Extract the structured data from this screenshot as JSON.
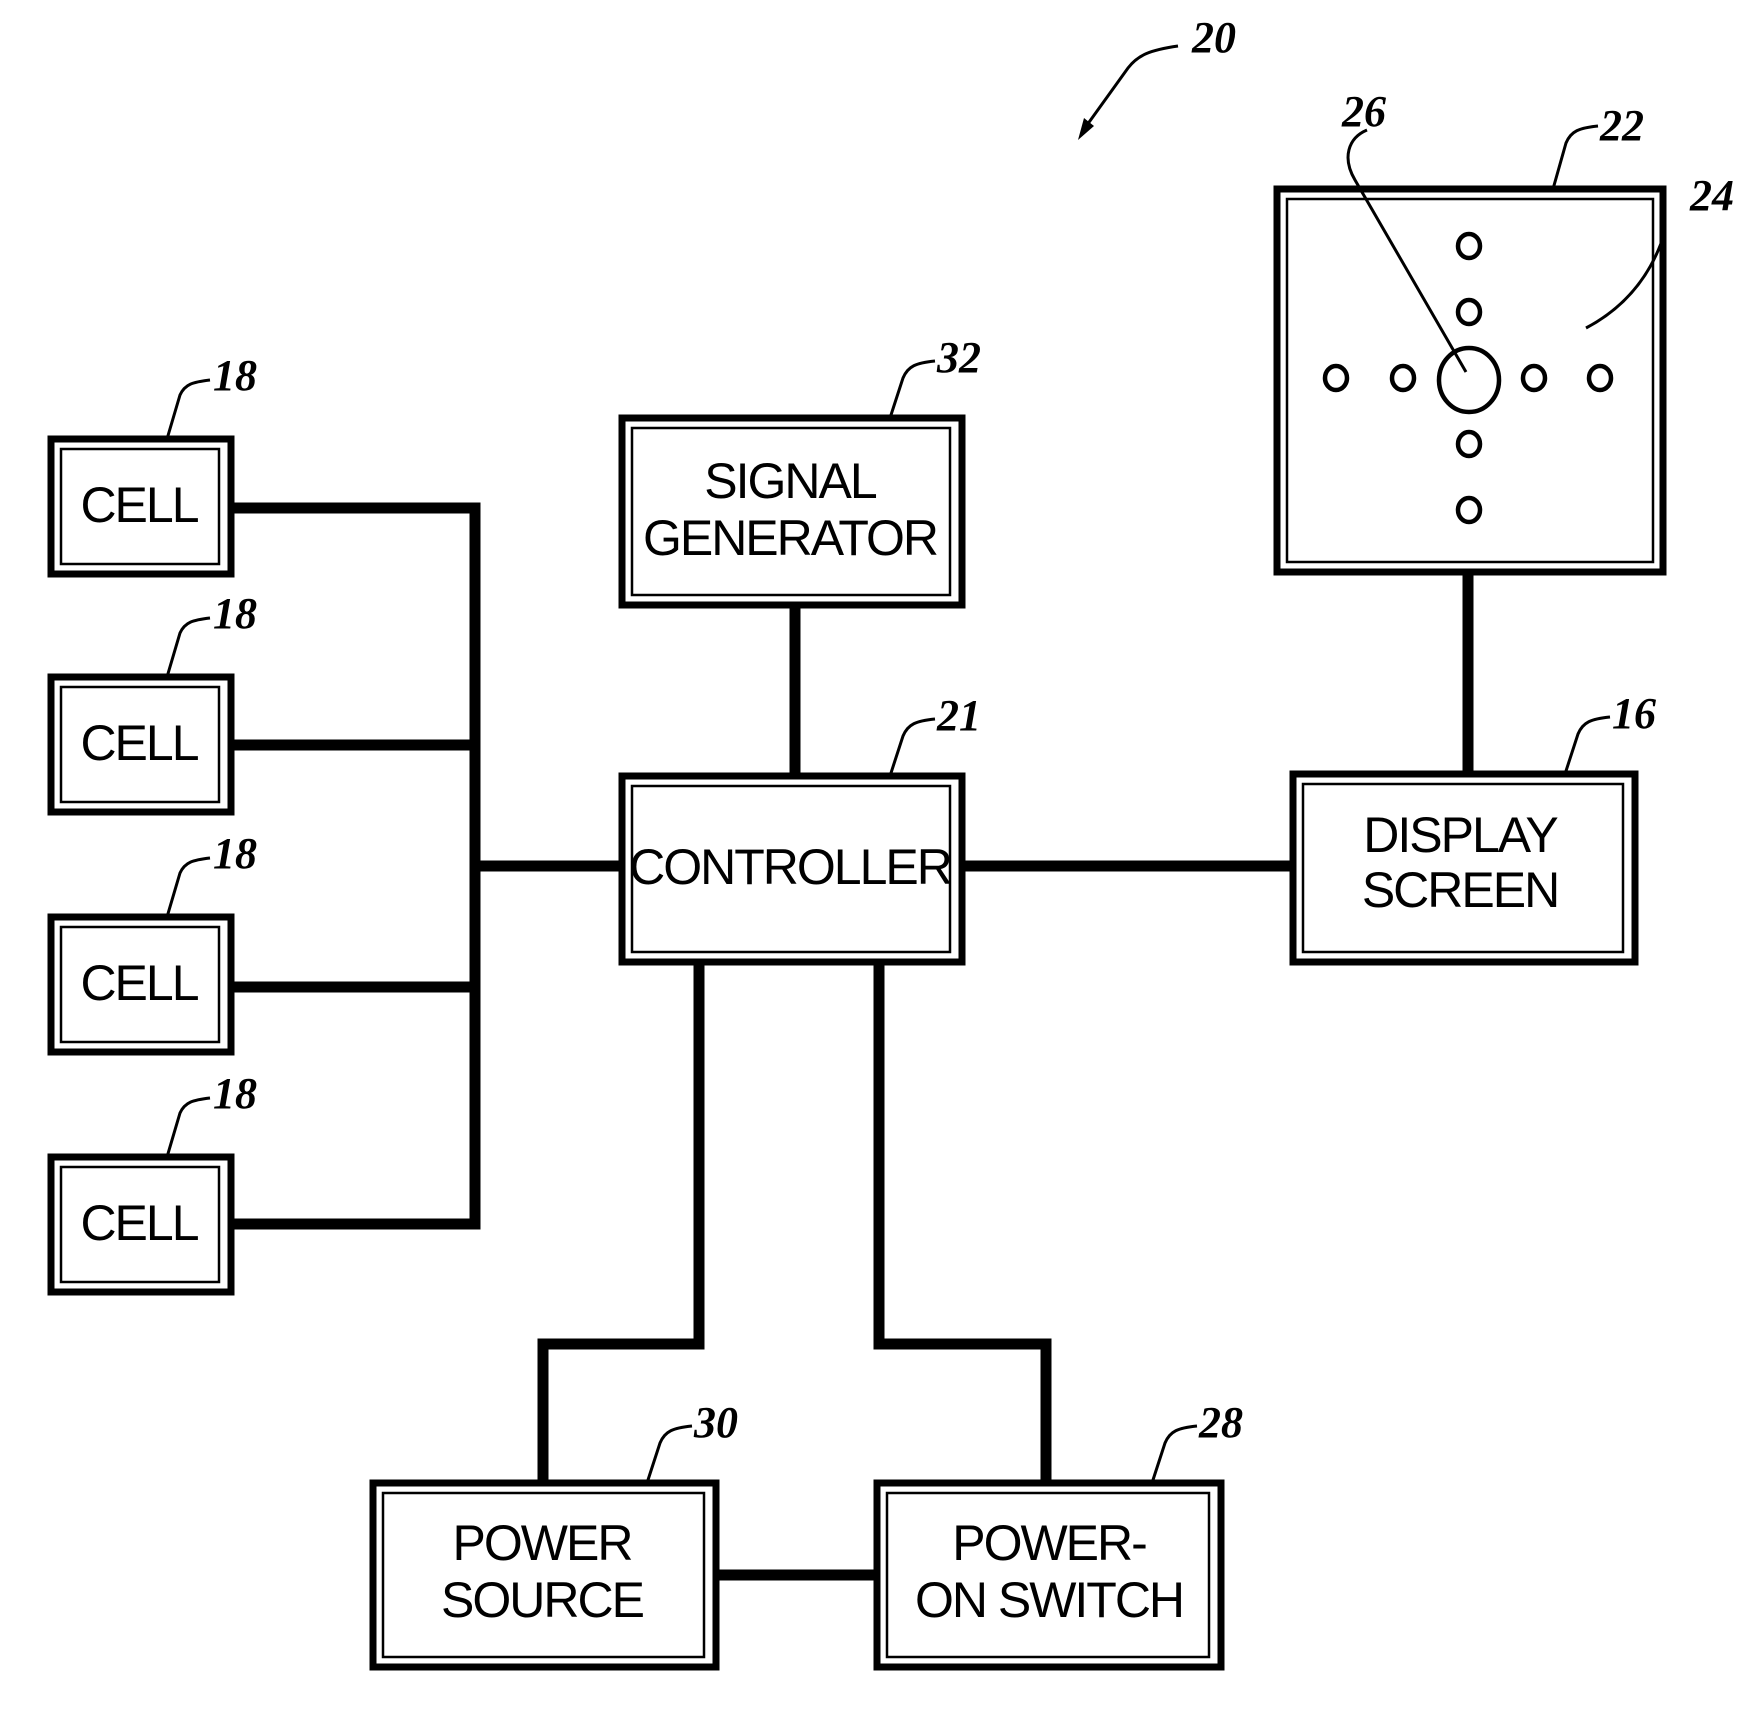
{
  "figure": {
    "ref": "20"
  },
  "cells": [
    {
      "label": "CELL",
      "ref": "18"
    },
    {
      "label": "CELL",
      "ref": "18"
    },
    {
      "label": "CELL",
      "ref": "18"
    },
    {
      "label": "CELL",
      "ref": "18"
    }
  ],
  "signal_generator": {
    "line1": "SIGNAL",
    "line2": "GENERATOR",
    "ref": "32"
  },
  "controller": {
    "label": "CONTROLLER",
    "ref": "21"
  },
  "display_screen": {
    "line1": "DISPLAY",
    "line2": "SCREEN",
    "ref": "16"
  },
  "panel": {
    "ref": "22",
    "surface_ref": "24",
    "center_ref": "26"
  },
  "power_source": {
    "line1": "POWER",
    "line2": "SOURCE",
    "ref": "30"
  },
  "power_switch": {
    "line1": "POWER-",
    "line2": "ON SWITCH",
    "ref": "28"
  }
}
